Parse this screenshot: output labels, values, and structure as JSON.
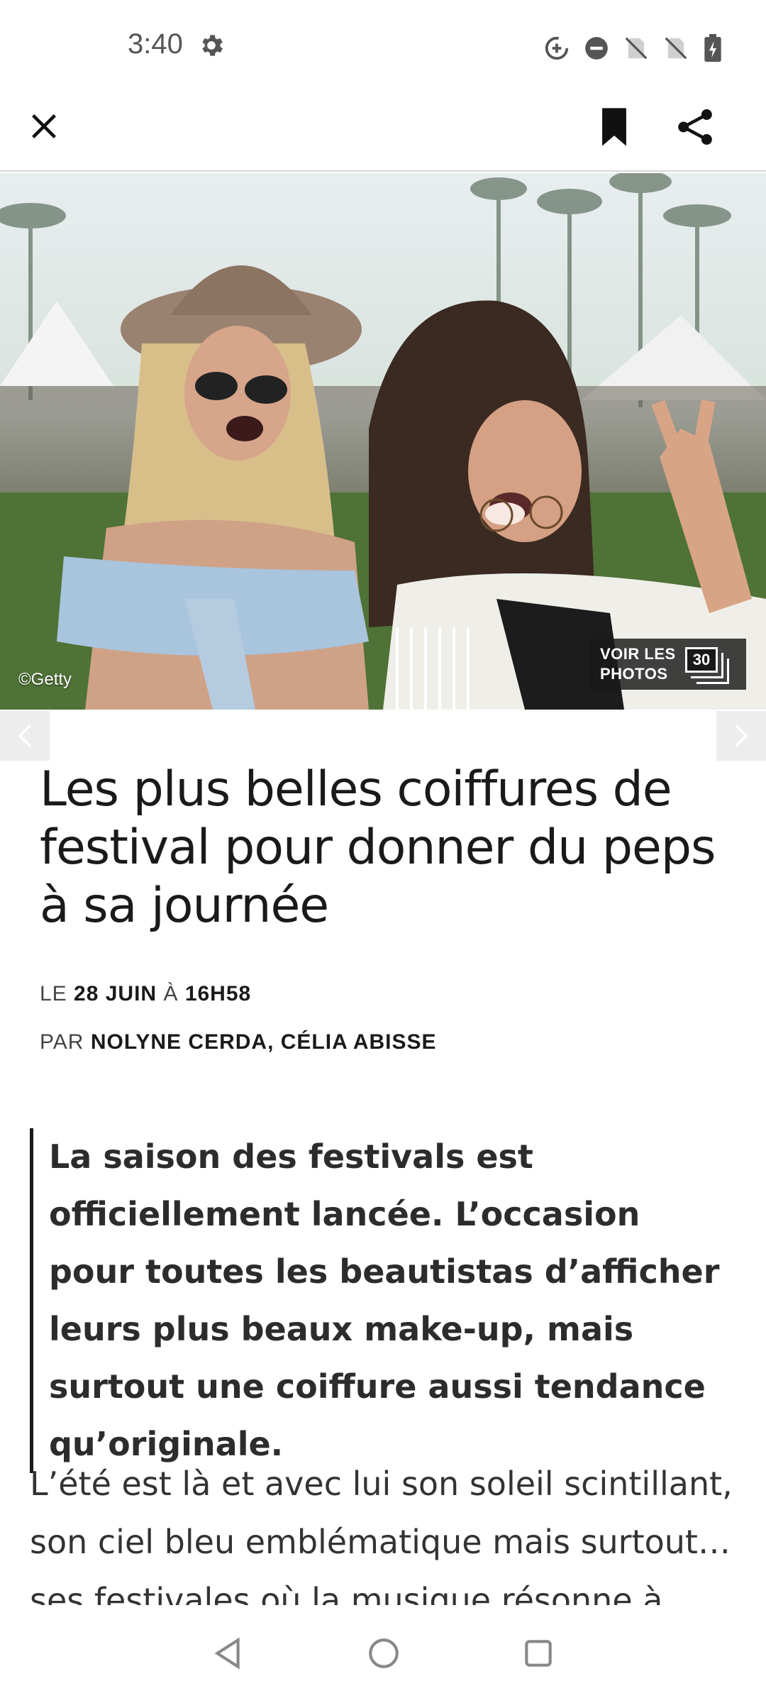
{
  "status_bar": {
    "time": "3:40",
    "icons": [
      "gear-icon",
      "data-saver-icon",
      "dnd-icon",
      "no-sim-icon",
      "no-sim-icon",
      "battery-charging-icon"
    ]
  },
  "app_bar": {
    "close_icon": "close-icon",
    "bookmark_icon": "bookmark-icon",
    "share_icon": "share-icon"
  },
  "hero": {
    "credit": "©Getty",
    "gallery_label": "VOIR LES PHOTOS",
    "gallery_count": "30"
  },
  "article": {
    "title": "Les plus belles coiffures de festival pour donner du peps à sa journée",
    "date_prefix": "LE",
    "date": "28 JUIN",
    "time_prefix": "À",
    "time": "16H58",
    "author_prefix": "PAR",
    "authors": "NOLYNE CERDA, CÉLIA ABISSE",
    "chapo": "La saison des festivals est officiellement lancée. L’occasion pour toutes les beautistas d’afficher leurs plus beaux make-up, mais surtout une coiffure aussi tendance qu’originale.",
    "body": "L’été est là et avec lui son soleil scintillant, son ciel bleu emblématique mais surtout… ses festivales où la musique résonne à tue-tête."
  },
  "colors": {
    "accent": "#1a1a1a",
    "carousel_bg": "#ededed",
    "gallery_bg": "#191919"
  }
}
